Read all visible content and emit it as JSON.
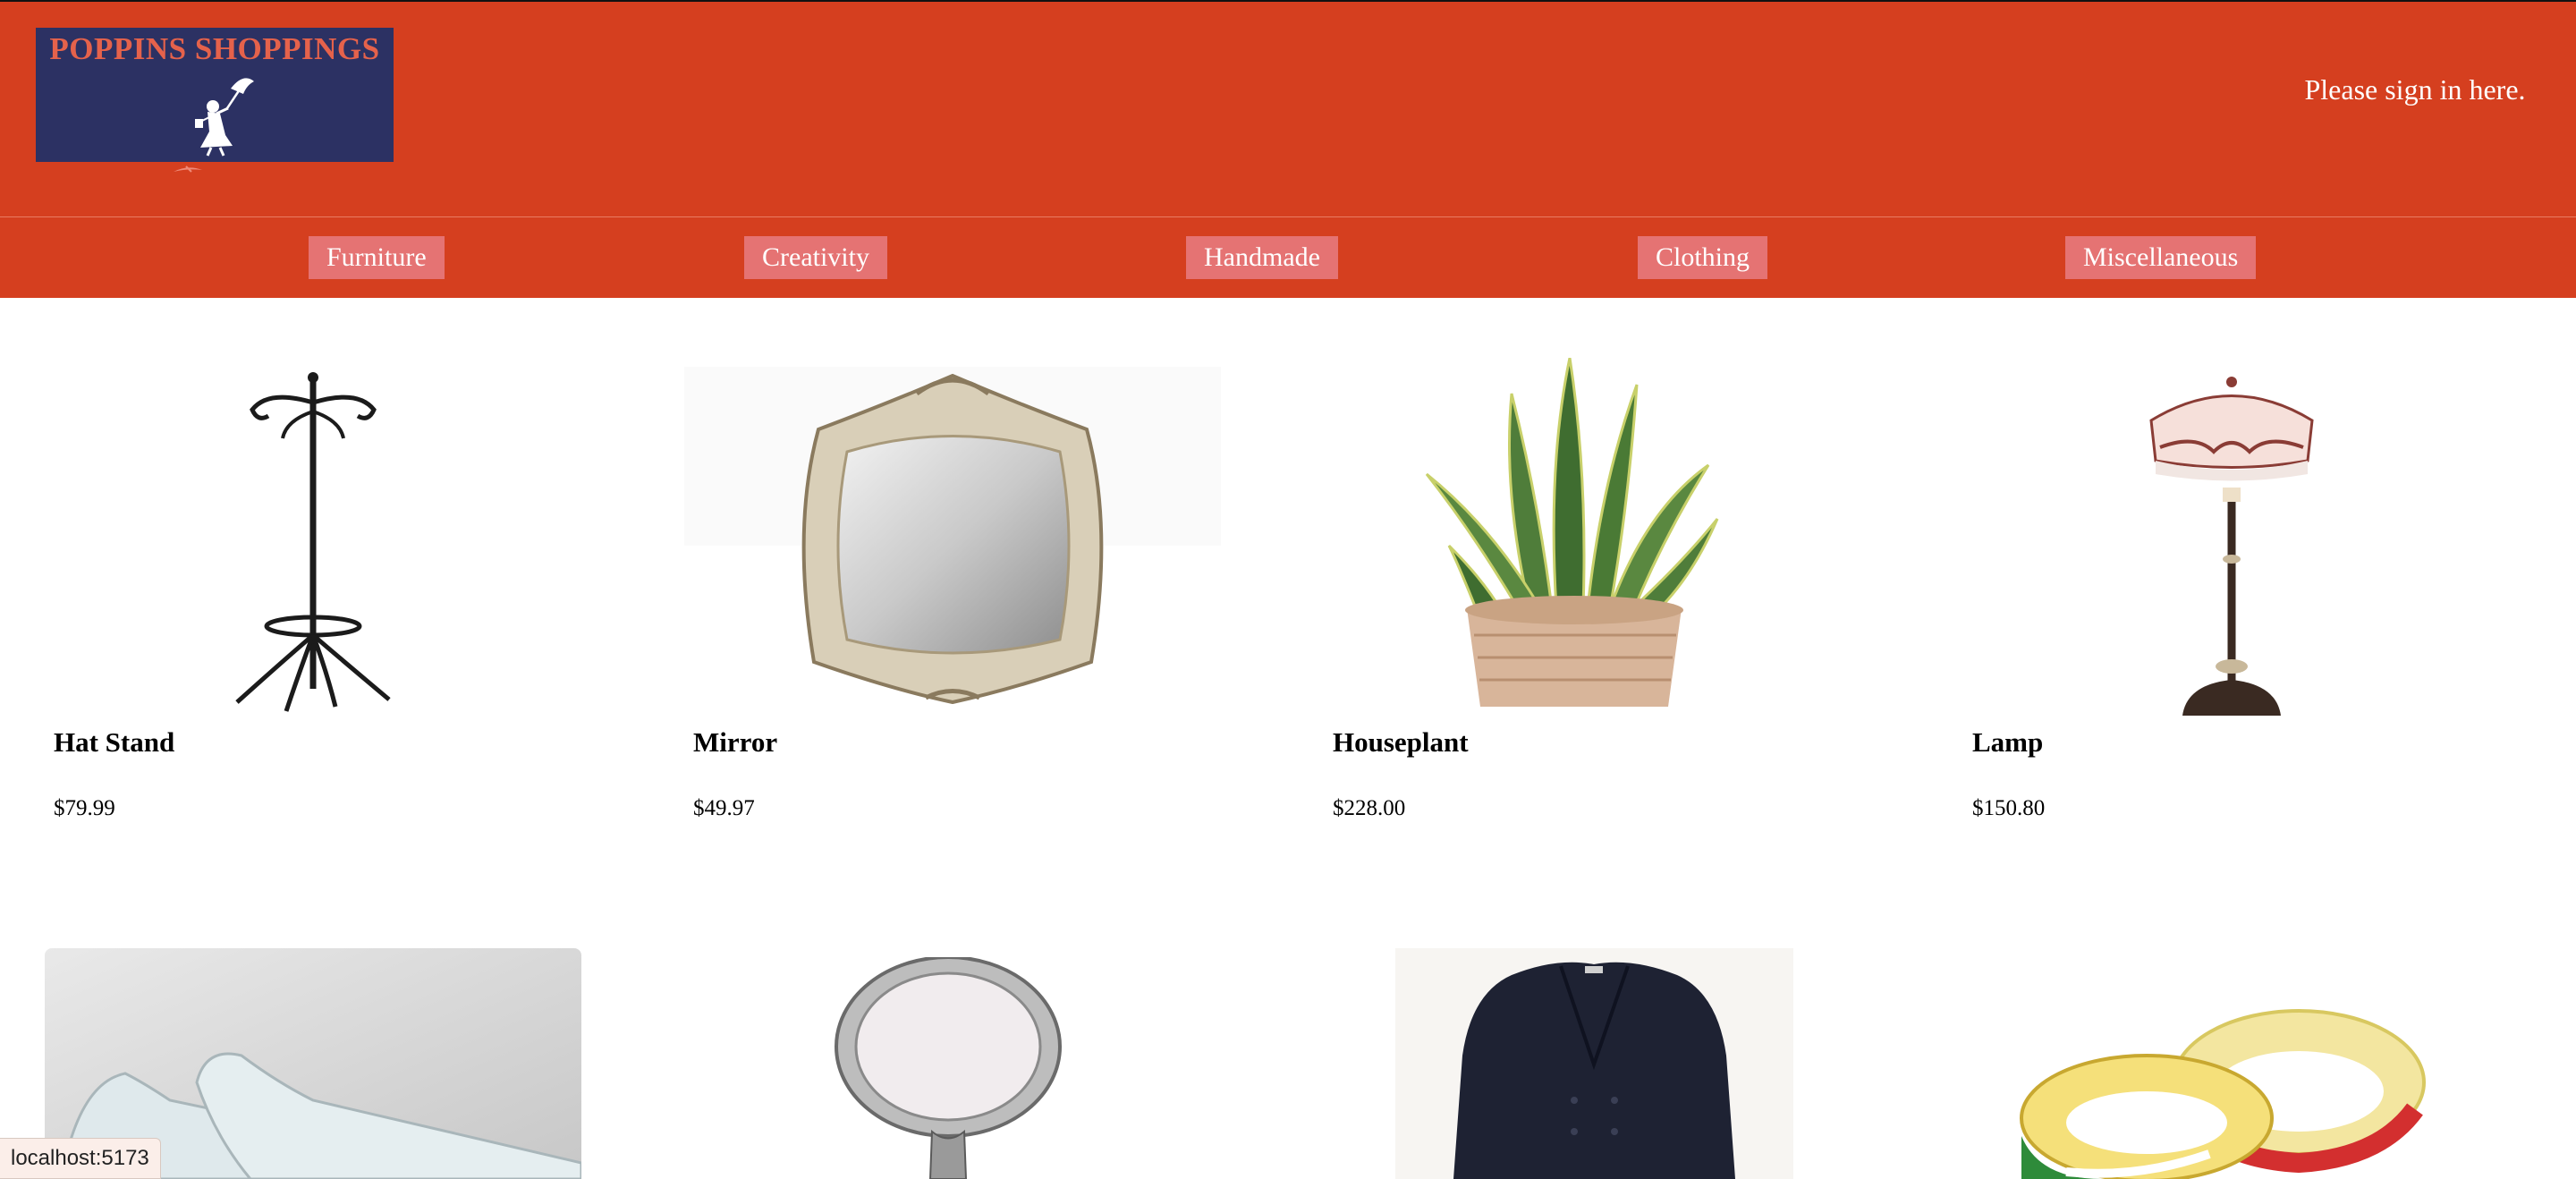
{
  "header": {
    "logo_text": "POPPINS SHOPPINGS",
    "signin_text": "Please sign in here.",
    "background": "#d53f1f",
    "logo_background": "#2c3163"
  },
  "nav": {
    "categories": [
      "Furniture",
      "Creativity",
      "Handmade",
      "Clothing",
      "Miscellaneous"
    ],
    "button_color": "#e57373"
  },
  "products": [
    {
      "name": "Hat Stand",
      "price": "$79.99",
      "image": "hat-stand"
    },
    {
      "name": "Mirror",
      "price": "$49.97",
      "image": "mirror"
    },
    {
      "name": "Houseplant",
      "price": "$228.00",
      "image": "houseplant"
    },
    {
      "name": "Lamp",
      "price": "$150.80",
      "image": "lamp"
    }
  ],
  "products_row2": [
    {
      "image": "shoes"
    },
    {
      "image": "hand-mirror"
    },
    {
      "image": "blazer"
    },
    {
      "image": "measuring-tape"
    }
  ],
  "status_bar": {
    "url": "localhost:5173"
  }
}
